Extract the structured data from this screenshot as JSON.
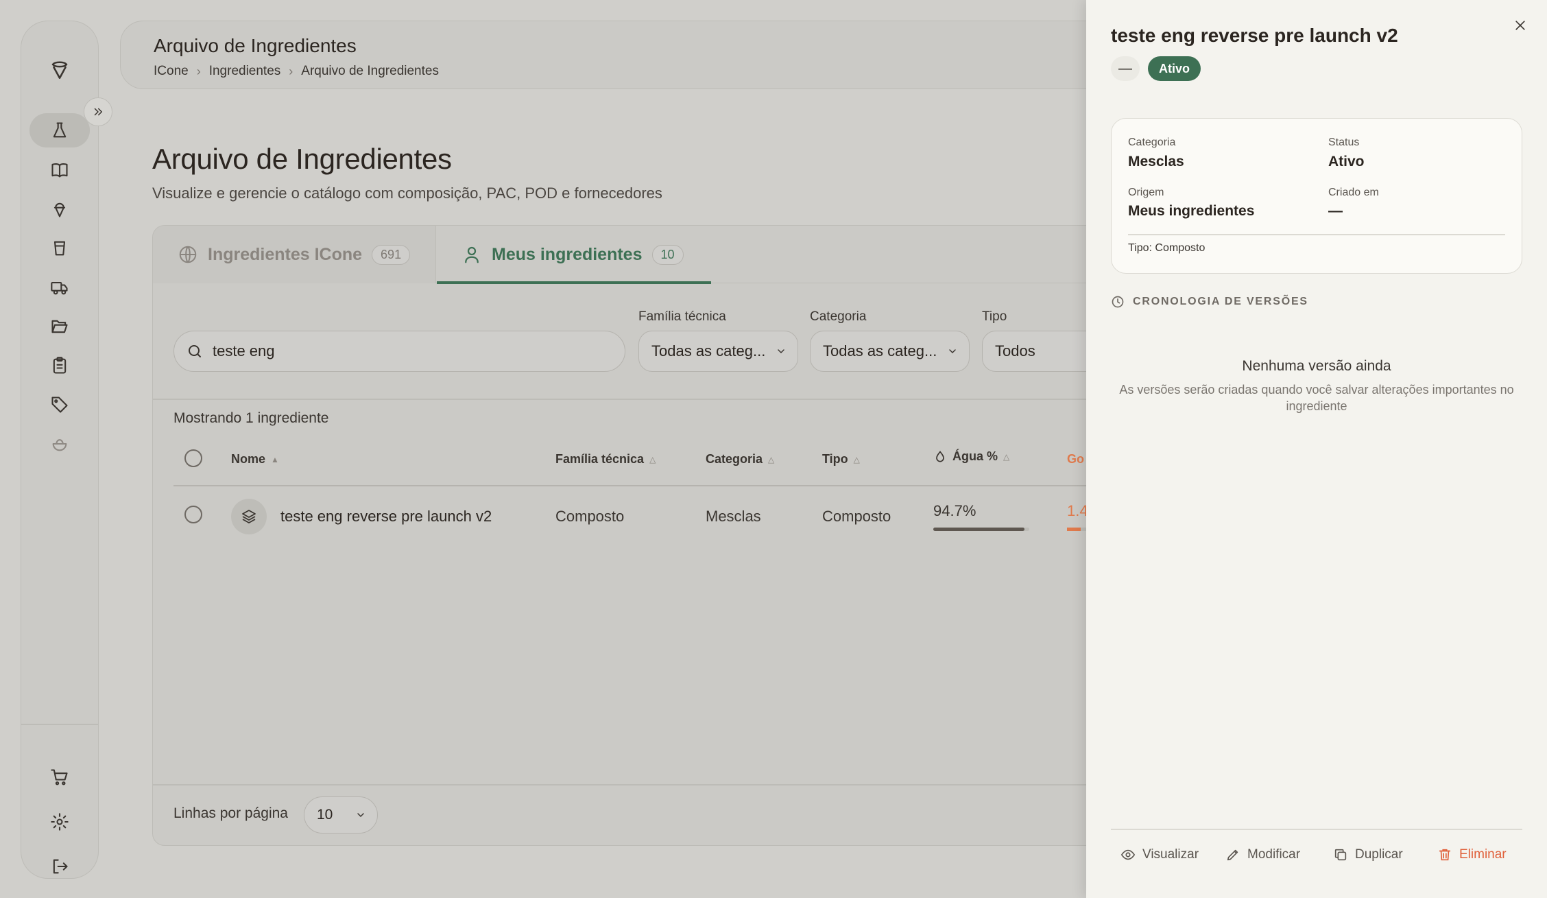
{
  "sidebar": {
    "items": [
      {
        "icon": "logo-icon"
      },
      {
        "icon": "flask-icon",
        "active": true
      },
      {
        "icon": "book-icon"
      },
      {
        "icon": "ice-cream-icon"
      },
      {
        "icon": "cup-icon"
      },
      {
        "icon": "truck-icon"
      },
      {
        "icon": "folder-icon"
      },
      {
        "icon": "clipboard-icon"
      },
      {
        "icon": "tag-icon"
      },
      {
        "icon": "bowl-icon"
      }
    ],
    "bottom": [
      {
        "icon": "cart-icon"
      },
      {
        "icon": "gear-icon"
      },
      {
        "icon": "logout-icon"
      }
    ]
  },
  "header": {
    "title": "Arquivo de Ingredientes",
    "breadcrumb": [
      "ICone",
      "Ingredientes",
      "Arquivo de Ingredientes"
    ]
  },
  "page": {
    "title": "Arquivo de Ingredientes",
    "subtitle": "Visualize e gerencie o catálogo com composição, PAC, POD e fornecedores"
  },
  "tabs": [
    {
      "label": "Ingredientes ICone",
      "count": "691",
      "icon": "globe-icon",
      "active": false
    },
    {
      "label": "Meus ingredientes",
      "count": "10",
      "icon": "user-icon",
      "active": true
    }
  ],
  "filters": {
    "search_value": "teste eng",
    "familia": {
      "label": "Família técnica",
      "value": "Todas as categ..."
    },
    "categoria": {
      "label": "Categoria",
      "value": "Todas as categ..."
    },
    "tipo": {
      "label": "Tipo",
      "value": "Todos"
    }
  },
  "table": {
    "showing": "Mostrando 1 ingrediente",
    "columns": [
      "Nome",
      "Família técnica",
      "Categoria",
      "Tipo",
      "Água %",
      "Go"
    ],
    "rows": [
      {
        "name": "teste eng reverse pre launch v2",
        "familia": "Composto",
        "categoria": "Mesclas",
        "tipo": "Composto",
        "agua": "94.7%",
        "agua_fraction": 0.947,
        "gordura": "1.4",
        "gordura_fraction": 0.05
      }
    ]
  },
  "pagination": {
    "label": "Linhas por página",
    "value": "10"
  },
  "drawer": {
    "title": "teste eng reverse pre launch v2",
    "dash": "—",
    "status_badge": "Ativo",
    "info": {
      "categoria_label": "Categoria",
      "categoria_value": "Mesclas",
      "status_label": "Status",
      "status_value": "Ativo",
      "origem_label": "Origem",
      "origem_value": "Meus ingredientes",
      "criado_label": "Criado em",
      "criado_value": "—",
      "tipo": "Tipo: Composto"
    },
    "timeline_title": "CRONOLOGIA DE VERSÕES",
    "empty_title": "Nenhuma versão ainda",
    "empty_desc": "As versões serão criadas quando você salvar alterações importantes no ingrediente",
    "actions": {
      "view": "Visualizar",
      "edit": "Modificar",
      "duplicate": "Duplicar",
      "delete": "Eliminar"
    }
  },
  "colors": {
    "accent": "#3d7054",
    "danger": "#e0603a",
    "drawer_bg": "#f4f3ee"
  }
}
